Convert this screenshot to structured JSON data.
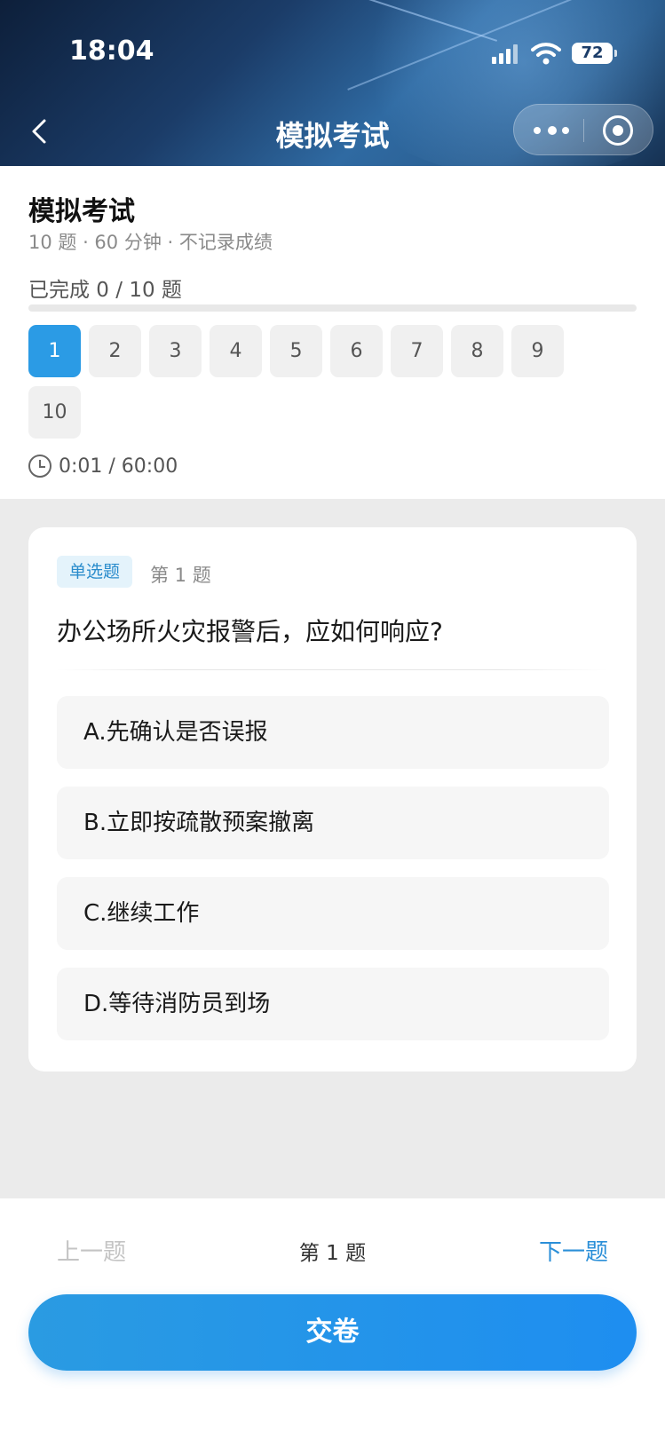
{
  "status_bar": {
    "time": "18:04",
    "battery": "72"
  },
  "nav": {
    "title": "模拟考试"
  },
  "exam": {
    "title": "模拟考试",
    "subtitle": "10 题 · 60 分钟 · 不记录成绩",
    "progress_label": "已完成 0 / 10 题",
    "progress_fraction": 0,
    "question_numbers": [
      "1",
      "2",
      "3",
      "4",
      "5",
      "6",
      "7",
      "8",
      "9",
      "10"
    ],
    "current_number": "1",
    "timer": "0:01 / 60:00"
  },
  "question": {
    "type": "单选题",
    "index": "第 1 题",
    "text": "办公场所火灾报警后，应如何响应?",
    "options": [
      "A.先确认是否误报",
      "B.立即按疏散预案撤离",
      "C.继续工作",
      "D.等待消防员到场"
    ]
  },
  "footer": {
    "prev_label": "上一题",
    "pager": "第 1 题",
    "next_label": "下一题",
    "submit_label": "交卷"
  },
  "colors": {
    "accent": "#2b9be5",
    "header_dark": "#163152"
  }
}
